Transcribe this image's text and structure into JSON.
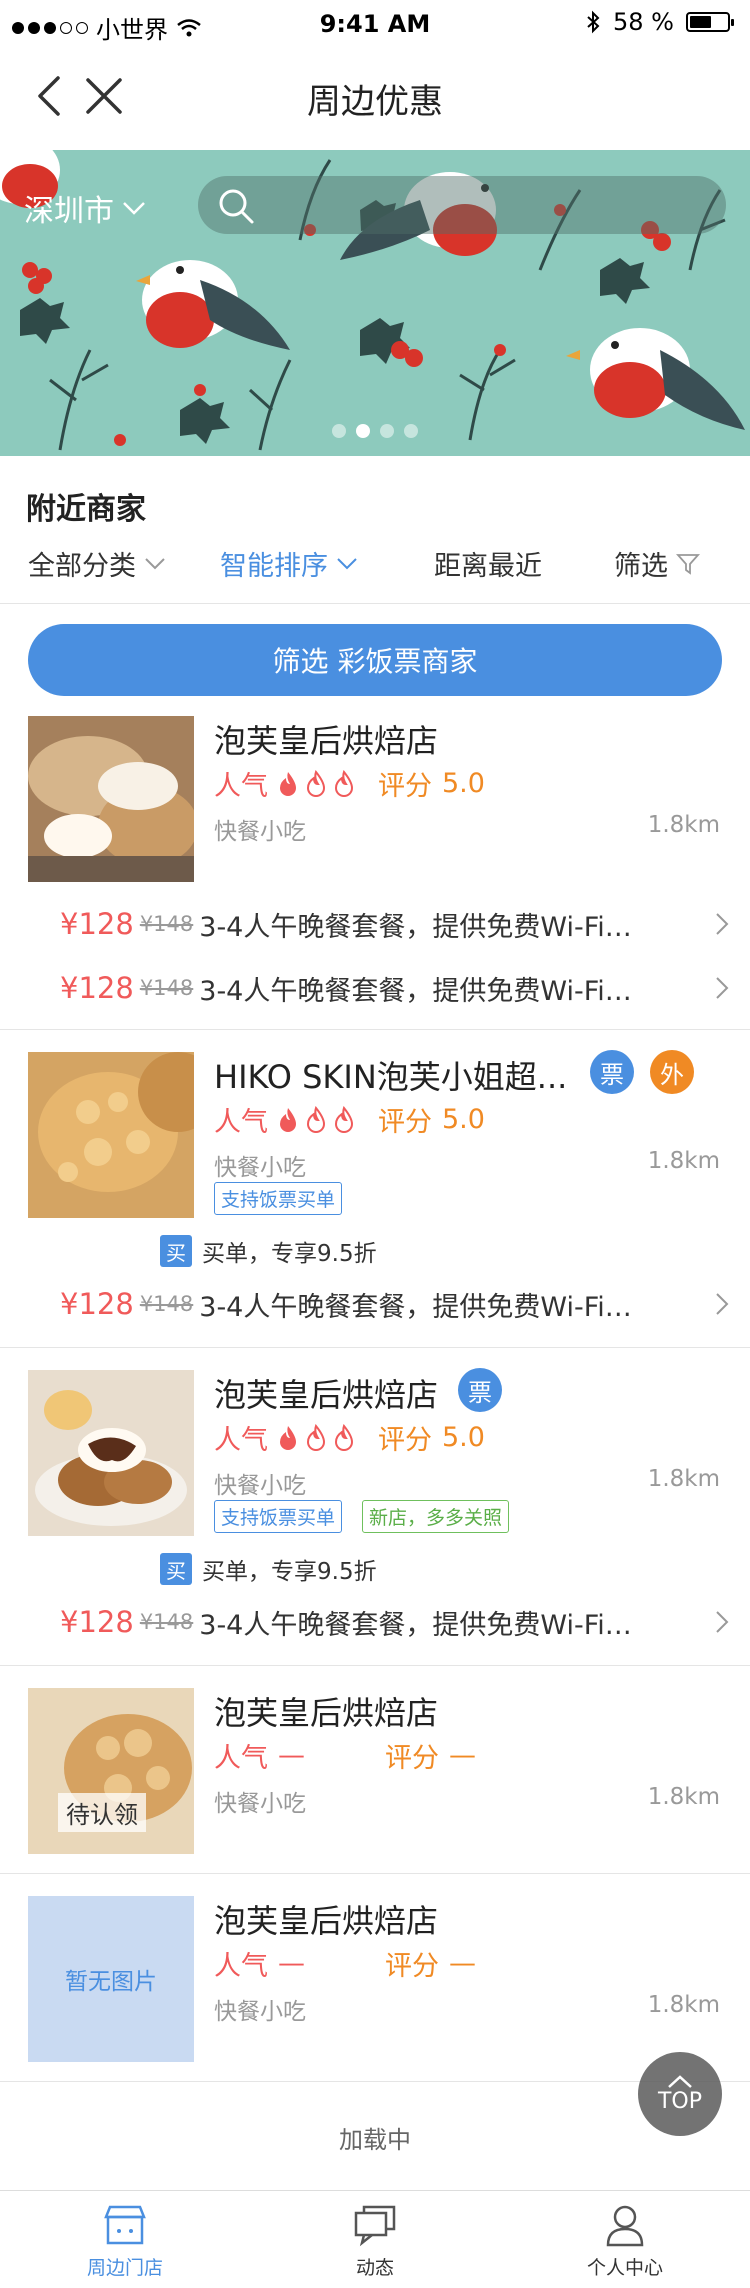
{
  "status_bar": {
    "carrier": "小世界",
    "time": "9:41 AM",
    "battery": "58 %",
    "battery_level": 0.58
  },
  "nav": {
    "title": "周边优惠"
  },
  "banner": {
    "city": "深圳市",
    "search_placeholder": "",
    "page_count": 4,
    "active_page": 1
  },
  "section_title": "附近商家",
  "filters": {
    "all_categories": "全部分类",
    "smart_sort": "智能排序",
    "nearest": "距离最近",
    "filter": "筛选"
  },
  "filter_button": "筛选 彩饭票商家",
  "labels": {
    "popularity": "人气",
    "score": "评分",
    "buy": "买",
    "ticket_badge": "票",
    "takeout_badge": "外",
    "claim": "待认领",
    "no_image": "暂无图片"
  },
  "shops": [
    {
      "name": "泡芙皇后烘焙店",
      "score": "5.0",
      "category": "快餐小吃",
      "distance": "1.8km",
      "deals": [
        {
          "price": "¥128",
          "old_price": "¥148",
          "desc": "3-4人午晚餐套餐，提供免费Wi-Fi…"
        },
        {
          "price": "¥128",
          "old_price": "¥148",
          "desc": "3-4人午晚餐套餐，提供免费Wi-Fi…"
        }
      ]
    },
    {
      "name": "HIKO SKIN泡芙小姐超...",
      "score": "5.0",
      "category": "快餐小吃",
      "distance": "1.8km",
      "tag": "支持饭票买单",
      "buy_text": "买单，专享9.5折",
      "deals": [
        {
          "price": "¥128",
          "old_price": "¥148",
          "desc": "3-4人午晚餐套餐，提供免费Wi-Fi…"
        }
      ]
    },
    {
      "name": "泡芙皇后烘焙店",
      "score": "5.0",
      "category": "快餐小吃",
      "distance": "1.8km",
      "tag": "支持饭票买单",
      "tag2": "新店，多多关照",
      "buy_text": "买单，专享9.5折",
      "deals": [
        {
          "price": "¥128",
          "old_price": "¥148",
          "desc": "3-4人午晚餐套餐，提供免费Wi-Fi…"
        }
      ]
    },
    {
      "name": "泡芙皇后烘焙店",
      "popularity_value": "—",
      "score": "—",
      "category": "快餐小吃",
      "distance": "1.8km"
    },
    {
      "name": "泡芙皇后烘焙店",
      "popularity_value": "—",
      "score": "—",
      "category": "快餐小吃",
      "distance": "1.8km"
    }
  ],
  "loading_text": "加载中",
  "top_button": "TOP",
  "tab_bar": {
    "tabs": [
      {
        "label": "周边门店",
        "active": true
      },
      {
        "label": "动态",
        "active": false
      },
      {
        "label": "个人中心",
        "active": false
      }
    ]
  },
  "colors": {
    "accent": "#4a8fe0",
    "price_red": "#f05a5a",
    "score_orange": "#f08a24",
    "banner_bg": "#8dcabd"
  },
  "icons": [
    "back-icon",
    "close-icon",
    "search-icon",
    "chevron-down-icon",
    "filter-funnel-icon",
    "chevron-right-icon",
    "flame-icon",
    "store-icon",
    "chat-icon",
    "person-icon",
    "arrow-up-icon",
    "bluetooth-icon",
    "wifi-icon"
  ]
}
